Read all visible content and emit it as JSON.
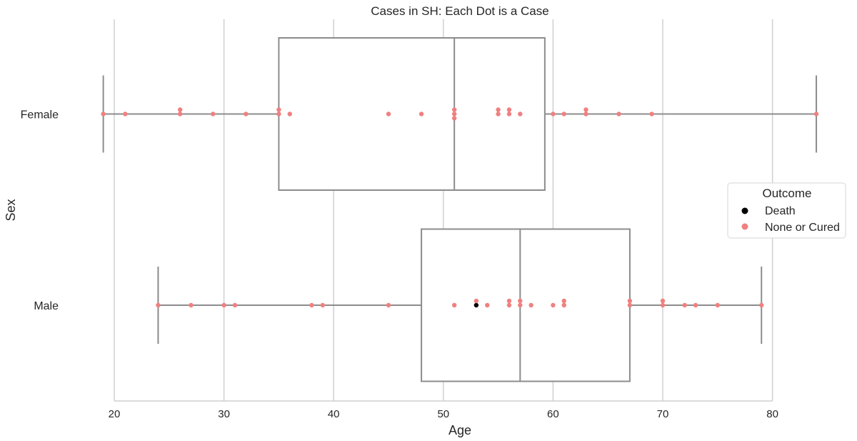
{
  "chart_data": {
    "type": "box",
    "title": "Cases in SH: Each Dot is a Case",
    "xlabel": "Age",
    "ylabel": "Sex",
    "xlim": [
      19,
      84
    ],
    "xticks": [
      20,
      30,
      40,
      50,
      60,
      70,
      80
    ],
    "xtick_labels": [
      "20",
      "30",
      "40",
      "50",
      "60",
      "70",
      "80"
    ],
    "grid": true,
    "categories": [
      "Female",
      "Male"
    ],
    "boxes": [
      {
        "category": "Female",
        "whisker_low": 19,
        "q1": 35,
        "median": 51,
        "q3": 59.25,
        "whisker_high": 84
      },
      {
        "category": "Male",
        "whisker_low": 24,
        "q1": 48,
        "median": 57,
        "q3": 67,
        "whisker_high": 79
      }
    ],
    "points": [
      {
        "category": "Female",
        "outcome": "None or Cured",
        "ages": [
          19,
          21,
          26,
          26,
          29,
          32,
          35,
          35,
          36,
          45,
          48,
          51,
          51,
          51,
          55,
          55,
          56,
          56,
          57,
          60,
          61,
          63,
          63,
          66,
          69,
          84
        ]
      },
      {
        "category": "Male",
        "outcome": "None or Cured",
        "ages": [
          24,
          27,
          30,
          31,
          38,
          39,
          45,
          51,
          53,
          54,
          56,
          56,
          57,
          57,
          58,
          60,
          61,
          61,
          67,
          67,
          70,
          70,
          72,
          73,
          75,
          79
        ]
      },
      {
        "category": "Male",
        "outcome": "Death",
        "ages": [
          53
        ]
      }
    ],
    "legend": {
      "title": "Outcome",
      "placement": "center-right",
      "entries": [
        {
          "label": "Death",
          "color": "#000000"
        },
        {
          "label": "None or Cured",
          "color": "#f08080"
        }
      ]
    },
    "colors": {
      "box": "#8c8c8c",
      "grid": "#d0d0d0"
    }
  }
}
